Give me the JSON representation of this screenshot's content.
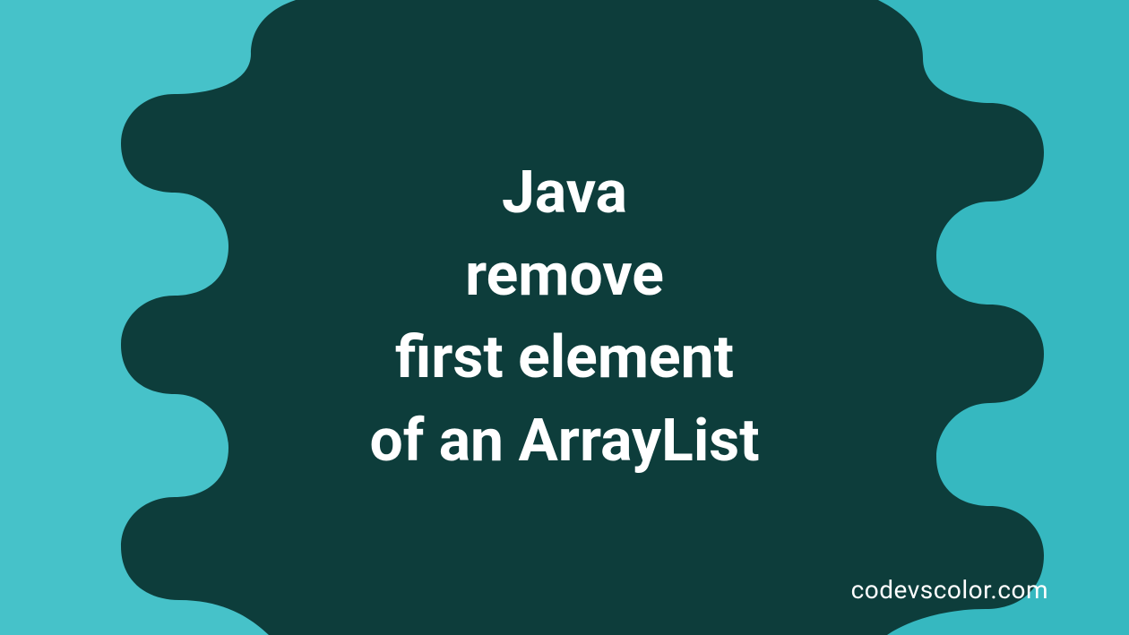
{
  "banner": {
    "title_lines": [
      "Java",
      "remove",
      "first element",
      "of an ArrayList"
    ],
    "watermark": "codevscolor.com",
    "colors": {
      "background_dark": "#0d3d3b",
      "background_teal_light": "#46c2c9",
      "background_teal_right": "#36b8c0",
      "text": "#ffffff"
    }
  }
}
